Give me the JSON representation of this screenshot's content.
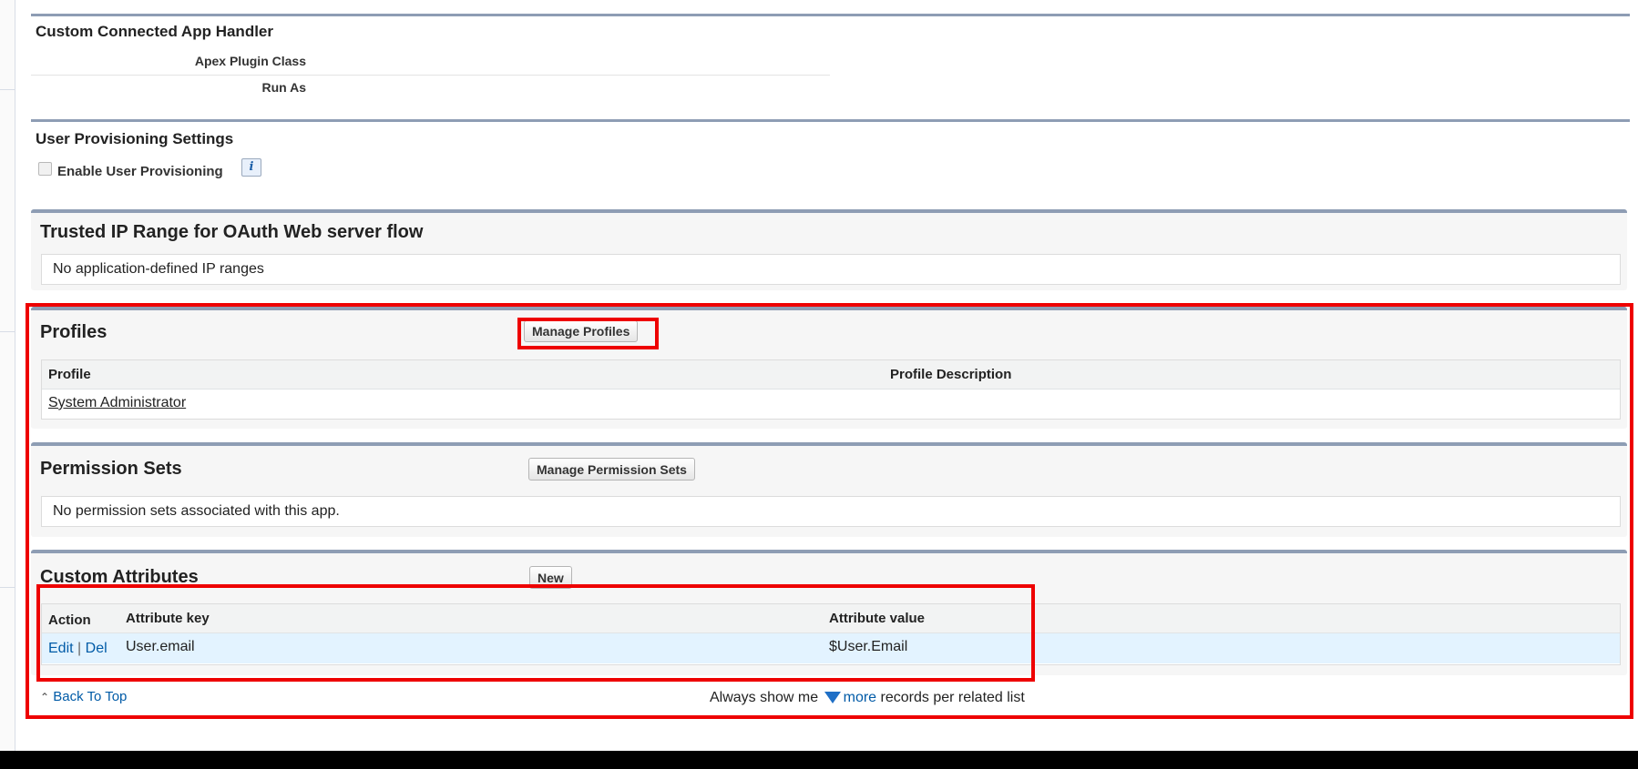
{
  "handler": {
    "title": "Custom Connected App Handler",
    "apex_plugin_class_label": "Apex Plugin Class",
    "run_as_label": "Run As"
  },
  "provisioning": {
    "title": "User Provisioning Settings",
    "enable_label": "Enable User Provisioning",
    "enable_checked": false,
    "info_icon": "i"
  },
  "trusted_ip": {
    "title": "Trusted IP Range for OAuth Web server flow",
    "message": "No application-defined IP ranges"
  },
  "profiles": {
    "title": "Profiles",
    "manage_button": "Manage Profiles",
    "columns": [
      "Profile",
      "Profile Description"
    ],
    "rows": [
      {
        "profile": "System Administrator",
        "description": ""
      }
    ]
  },
  "permission_sets": {
    "title": "Permission Sets",
    "manage_button": "Manage Permission Sets",
    "message": "No permission sets associated with this app."
  },
  "custom_attributes": {
    "title": "Custom Attributes",
    "new_button": "New",
    "columns": [
      "Action",
      "Attribute key",
      "Attribute value"
    ],
    "rows": [
      {
        "edit": "Edit",
        "separator": "|",
        "del": "Del",
        "key": "User.email",
        "value": "$User.Email"
      }
    ]
  },
  "footer": {
    "back_to_top": "Back To Top",
    "always_show": "Always show me",
    "more": "more",
    "records_suffix": "records per related list"
  },
  "colors": {
    "highlight": "#ee0000",
    "link": "#015ba7",
    "section_rule": "#8e9db4",
    "row_highlight": "#e3f3ff"
  }
}
